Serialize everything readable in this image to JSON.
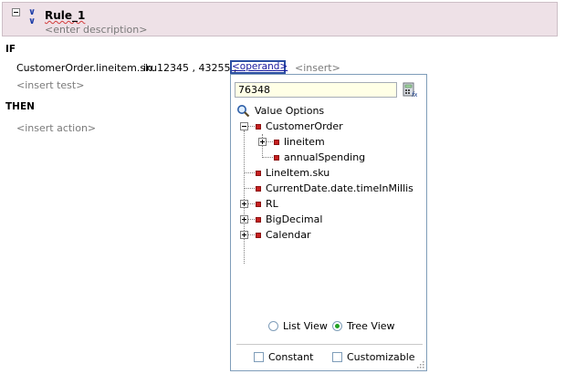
{
  "rule": {
    "name": "Rule_1",
    "description": "<enter description>"
  },
  "if_section": {
    "keyword": "IF",
    "test": {
      "left": "CustomerOrder.lineitem.sku",
      "operator": "in",
      "values": "12345 , 43255 ,",
      "operand_label": "<operand>",
      "insert_label": "<insert>"
    },
    "insert_test_label": "<insert test>"
  },
  "then_section": {
    "keyword": "THEN",
    "insert_action_label": "<insert action>"
  },
  "popup": {
    "input_value": "76348",
    "calculator_icon": "expression-builder-icon",
    "value_options_label": "Value Options",
    "tree": [
      {
        "label": "CustomerOrder",
        "expanded": true
      },
      {
        "label": "lineitem",
        "expanded": false
      },
      {
        "label": "annualSpending"
      },
      {
        "label": "LineItem.sku"
      },
      {
        "label": "CurrentDate.date.timeInMillis"
      },
      {
        "label": "RL",
        "expanded": false
      },
      {
        "label": "BigDecimal",
        "expanded": false
      },
      {
        "label": "Calendar",
        "expanded": false
      }
    ],
    "view": {
      "list_view_label": "List View",
      "tree_view_label": "Tree View",
      "selected": "Tree View"
    },
    "options": {
      "constant_label": "Constant",
      "constant_checked": false,
      "customizable_label": "Customizable",
      "customizable_checked": false
    }
  },
  "colors": {
    "rule_header_bg": "#eee1e7",
    "operand_border": "#2c4fa3",
    "input_bg": "#ffffe6",
    "tree_bullet": "#c62020"
  }
}
